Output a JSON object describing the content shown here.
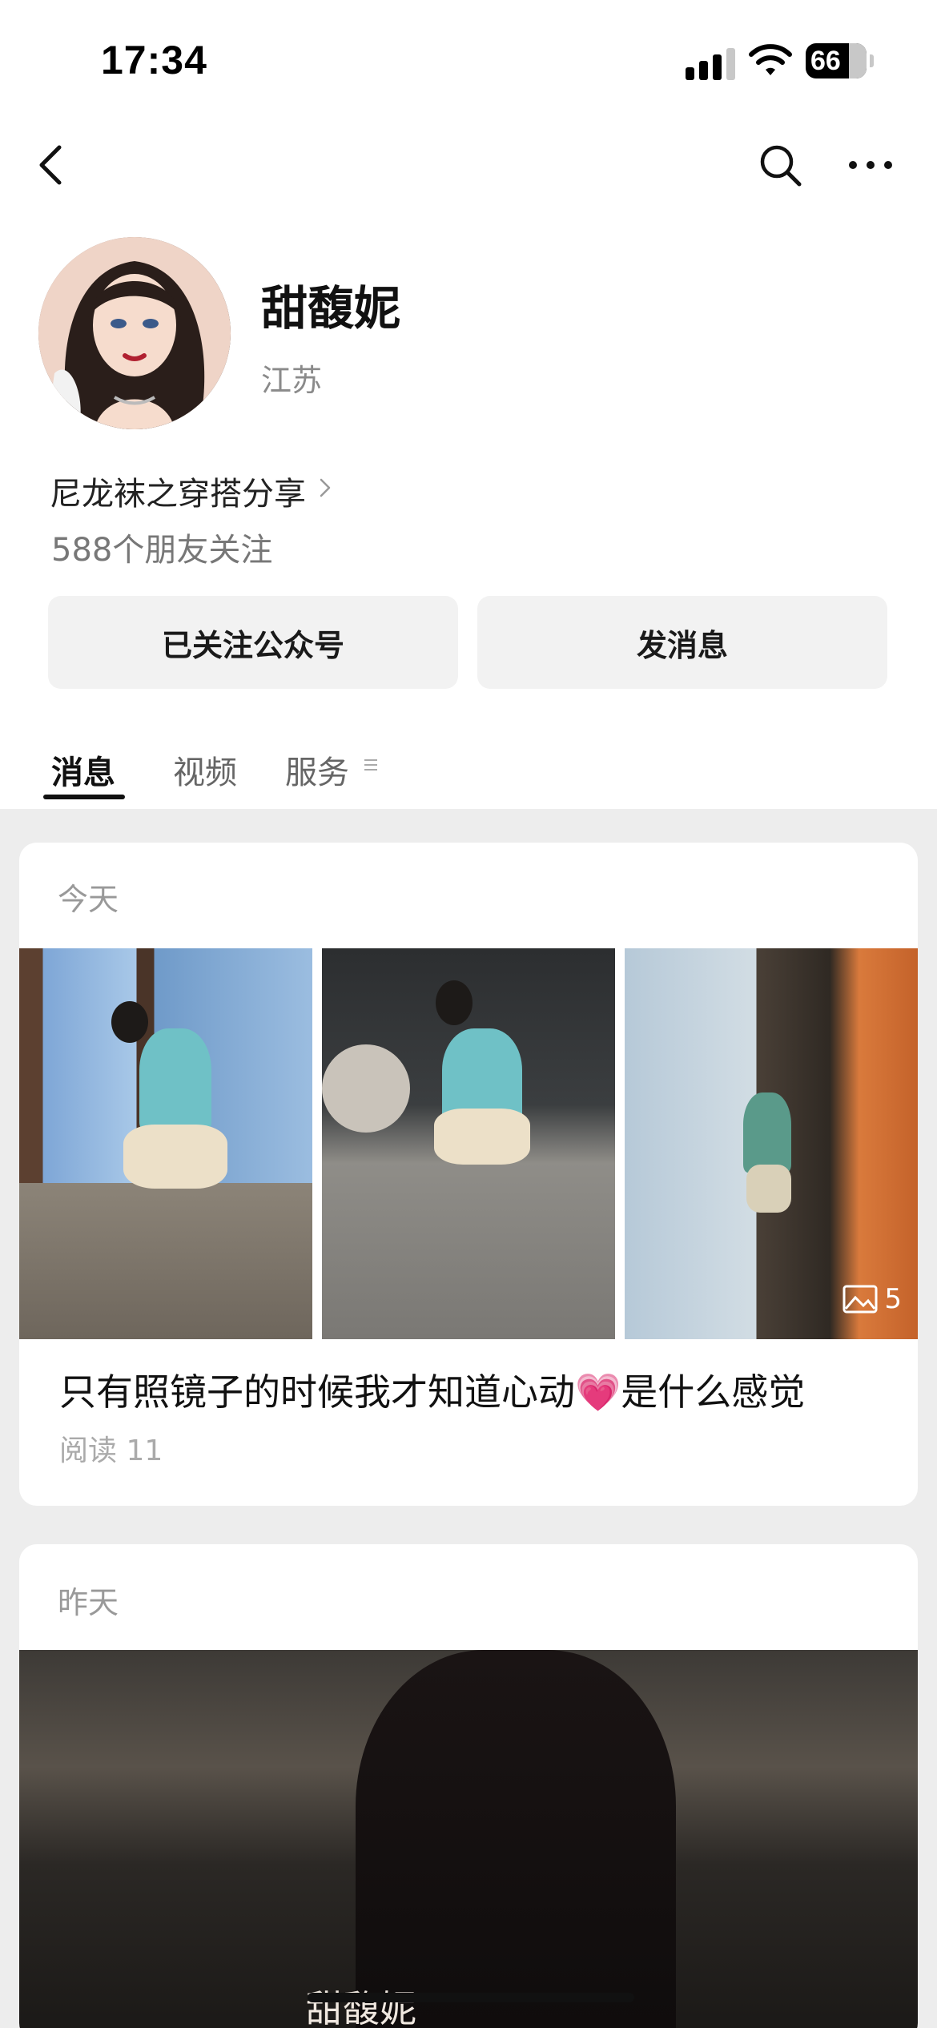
{
  "status_bar": {
    "time": "17:34",
    "battery": "66"
  },
  "nav": {
    "back_icon": "back-chevron-icon",
    "search_icon": "search-icon",
    "more_icon": "more-dots-icon"
  },
  "profile": {
    "name": "甜馥妮",
    "region": "江苏",
    "description": "尼龙袜之穿搭分享",
    "friends_following": "588个朋友关注"
  },
  "buttons": {
    "follow": "已关注公众号",
    "message": "发消息"
  },
  "tabs": [
    {
      "label": "消息",
      "active": true
    },
    {
      "label": "视频",
      "active": false
    },
    {
      "label": "服务",
      "active": false
    }
  ],
  "posts": [
    {
      "date": "今天",
      "title_before": "只有照镜子的时候我才知道心动",
      "title_emoji": "💗",
      "title_after": "是什么感觉",
      "read": "阅读 11",
      "image_count": "5"
    },
    {
      "date": "昨天",
      "watermark": "甜馥妮"
    }
  ],
  "colors": {
    "accent_heart": "#e0559a",
    "button_bg": "#f2f2f2",
    "page_bg": "#ededed"
  }
}
